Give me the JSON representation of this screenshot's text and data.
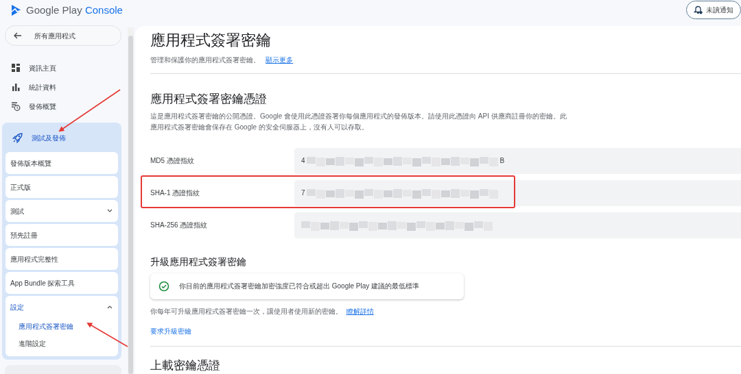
{
  "header": {
    "logo_text": "Google Play",
    "logo_accent": "Console",
    "notifications_button": "未讀通知"
  },
  "sidebar": {
    "back_button": "所有應用程式",
    "items": [
      {
        "label": "資訊主頁"
      },
      {
        "label": "統計資料"
      },
      {
        "label": "發佈概覽"
      }
    ],
    "group": {
      "label": "測試及發佈",
      "expanded": true,
      "pointed_at": true,
      "children": [
        {
          "label": "發佈版本概覽",
          "expandable": false
        },
        {
          "label": "正式版",
          "expandable": false
        },
        {
          "label": "測試",
          "expandable": true,
          "expanded": false
        },
        {
          "label": "預先註冊",
          "expandable": false
        },
        {
          "label": "應用程式完整性",
          "expandable": false
        },
        {
          "label": "App Bundle 探索工具",
          "expandable": false
        },
        {
          "label": "設定",
          "expandable": true,
          "expanded": true,
          "children": [
            {
              "label": "應用程式簽署密鑰",
              "selected": true,
              "pointed_at": true
            },
            {
              "label": "進階設定",
              "selected": false,
              "pointed_at": false
            }
          ]
        }
      ]
    }
  },
  "main": {
    "title": "應用程式簽署密鑰",
    "subtitle": "管理和保護你的應用程式簽署密鑰。",
    "subtitle_link": "顯示更多",
    "certificate": {
      "heading": "應用程式簽署密鑰憑證",
      "description": "這是應用程式簽署密鑰的公開憑證。Google 會使用此憑證簽署你每個應用程式的發佈版本。請使用此憑證向 API 供應商註冊你的密鑰。此應用程式簽署密鑰會保存在 Google 的安全伺服器上，沒有人可以存取。",
      "fingerprints": [
        {
          "label": "MD5 憑證指紋",
          "value_start": "4",
          "value_end": "B",
          "highlighted": false
        },
        {
          "label": "SHA-1 憑證指紋",
          "value_start": "7",
          "highlighted": true
        },
        {
          "label": "SHA-256 憑證指紋",
          "highlighted": false
        }
      ]
    },
    "upgrade": {
      "heading": "升級應用程式簽署密鑰",
      "status": "你目前的應用程式簽署密鑰加密強度已符合或超出 Google Play 建議的最低標準",
      "note": "你每年可升級應用程式簽署密鑰一次，讓使用者使用新的密鑰。",
      "note_link": "瞭解詳情",
      "action": "要求升級密鑰"
    },
    "upload_heading": "上載密鑰憑證"
  }
}
